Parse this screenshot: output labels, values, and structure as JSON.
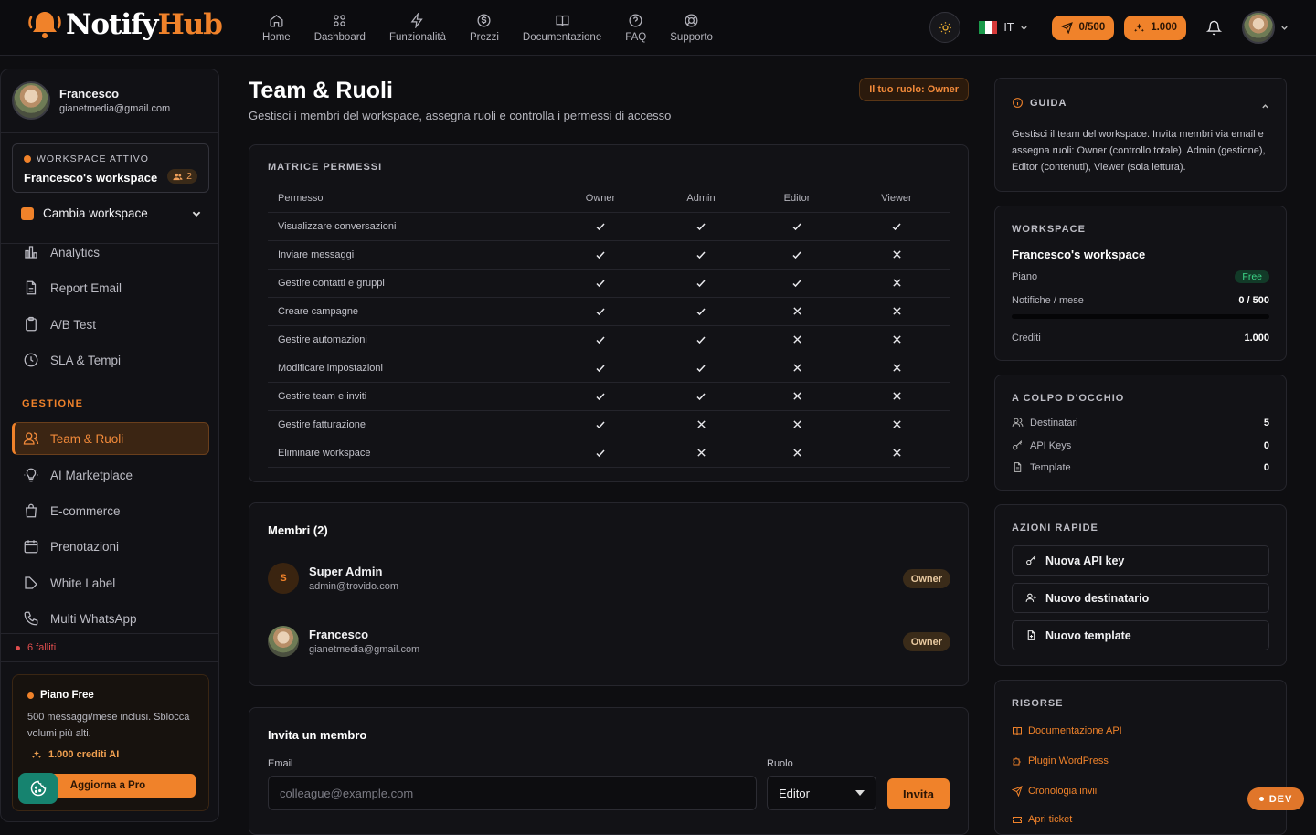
{
  "app": {
    "logo_pre": "Notify",
    "logo_post": "Hub"
  },
  "nav": [
    {
      "label": "Home",
      "icon": "home-icon"
    },
    {
      "label": "Dashboard",
      "icon": "grid-icon"
    },
    {
      "label": "Funzionalità",
      "icon": "bolt-icon"
    },
    {
      "label": "Prezzi",
      "icon": "dollar-icon"
    },
    {
      "label": "Documentazione",
      "icon": "book-icon"
    },
    {
      "label": "FAQ",
      "icon": "help-icon"
    },
    {
      "label": "Supporto",
      "icon": "lifebuoy-icon"
    }
  ],
  "topbar": {
    "lang": "IT",
    "quota_pill": "0/500",
    "credits_pill": "1.000"
  },
  "sidebar": {
    "user_name": "Francesco",
    "user_email": "gianetmedia@gmail.com",
    "ws_label": "WORKSPACE ATTIVO",
    "ws_name": "Francesco's workspace",
    "ws_count": "2",
    "switch_label": "Cambia workspace",
    "items_top": [
      "Analytics",
      "Report Email",
      "A/B Test",
      "SLA & Tempi"
    ],
    "section": "GESTIONE",
    "items_gestione": [
      "Team & Ruoli",
      "AI Marketplace",
      "E-commerce",
      "Prenotazioni",
      "White Label",
      "Multi WhatsApp"
    ],
    "failed": "6 falliti",
    "plan_title": "Piano Free",
    "plan_desc": "500 messaggi/mese inclusi. Sblocca volumi più alti.",
    "plan_credits": "1.000",
    "plan_credits_suffix": "crediti AI",
    "upgrade": "Aggiorna a Pro"
  },
  "page": {
    "title": "Team & Ruoli",
    "subtitle": "Gestisci i membri del workspace, assegna ruoli e controlla i permessi di accesso",
    "role_badge": "Il tuo ruolo: Owner"
  },
  "matrix": {
    "heading": "MATRICE PERMESSI",
    "columns": [
      "Permesso",
      "Owner",
      "Admin",
      "Editor",
      "Viewer"
    ],
    "rows": [
      {
        "label": "Visualizzare conversazioni",
        "v": [
          true,
          true,
          true,
          true
        ]
      },
      {
        "label": "Inviare messaggi",
        "v": [
          true,
          true,
          true,
          false
        ]
      },
      {
        "label": "Gestire contatti e gruppi",
        "v": [
          true,
          true,
          true,
          false
        ]
      },
      {
        "label": "Creare campagne",
        "v": [
          true,
          true,
          false,
          false
        ]
      },
      {
        "label": "Gestire automazioni",
        "v": [
          true,
          true,
          false,
          false
        ]
      },
      {
        "label": "Modificare impostazioni",
        "v": [
          true,
          true,
          false,
          false
        ]
      },
      {
        "label": "Gestire team e inviti",
        "v": [
          true,
          true,
          false,
          false
        ]
      },
      {
        "label": "Gestire fatturazione",
        "v": [
          true,
          false,
          false,
          false
        ]
      },
      {
        "label": "Eliminare workspace",
        "v": [
          true,
          false,
          false,
          false
        ]
      }
    ]
  },
  "members": {
    "heading": "Membri (2)",
    "list": [
      {
        "initial": "S",
        "name": "Super Admin",
        "email": "admin@trovido.com",
        "role": "Owner"
      },
      {
        "initial": "",
        "name": "Francesco",
        "email": "gianetmedia@gmail.com",
        "role": "Owner"
      }
    ]
  },
  "invite": {
    "heading": "Invita un membro",
    "email_label": "Email",
    "email_placeholder": "colleague@example.com",
    "role_label": "Ruolo",
    "role_value": "Editor",
    "button": "Invita"
  },
  "guide": {
    "heading": "GUIDA",
    "text": "Gestisci il team del workspace. Invita membri via email e assegna ruoli: Owner (controllo totale), Admin (gestione), Editor (contenuti), Viewer (sola lettura)."
  },
  "workspace_card": {
    "heading": "WORKSPACE",
    "name": "Francesco's workspace",
    "plan_label": "Piano",
    "plan_value": "Free",
    "notif_label": "Notifiche / mese",
    "notif_value": "0 / 500",
    "notif_progress": 0,
    "credits_label": "Crediti",
    "credits_value": "1.000"
  },
  "glance": {
    "heading": "A COLPO D'OCCHIO",
    "rows": [
      {
        "label": "Destinatari",
        "value": "5"
      },
      {
        "label": "API Keys",
        "value": "0"
      },
      {
        "label": "Template",
        "value": "0"
      }
    ]
  },
  "quick": {
    "heading": "AZIONI RAPIDE",
    "items": [
      "Nuova API key",
      "Nuovo destinatario",
      "Nuovo template"
    ]
  },
  "resources": {
    "heading": "RISORSE",
    "items": [
      "Documentazione API",
      "Plugin WordPress",
      "Cronologia invii",
      "Apri ticket"
    ]
  },
  "dev_badge": "DEV",
  "colors": {
    "accent": "#f0822a",
    "bg": "#0e0e11",
    "card": "#121216",
    "fab": "#16836f",
    "danger": "#e04e4e"
  }
}
